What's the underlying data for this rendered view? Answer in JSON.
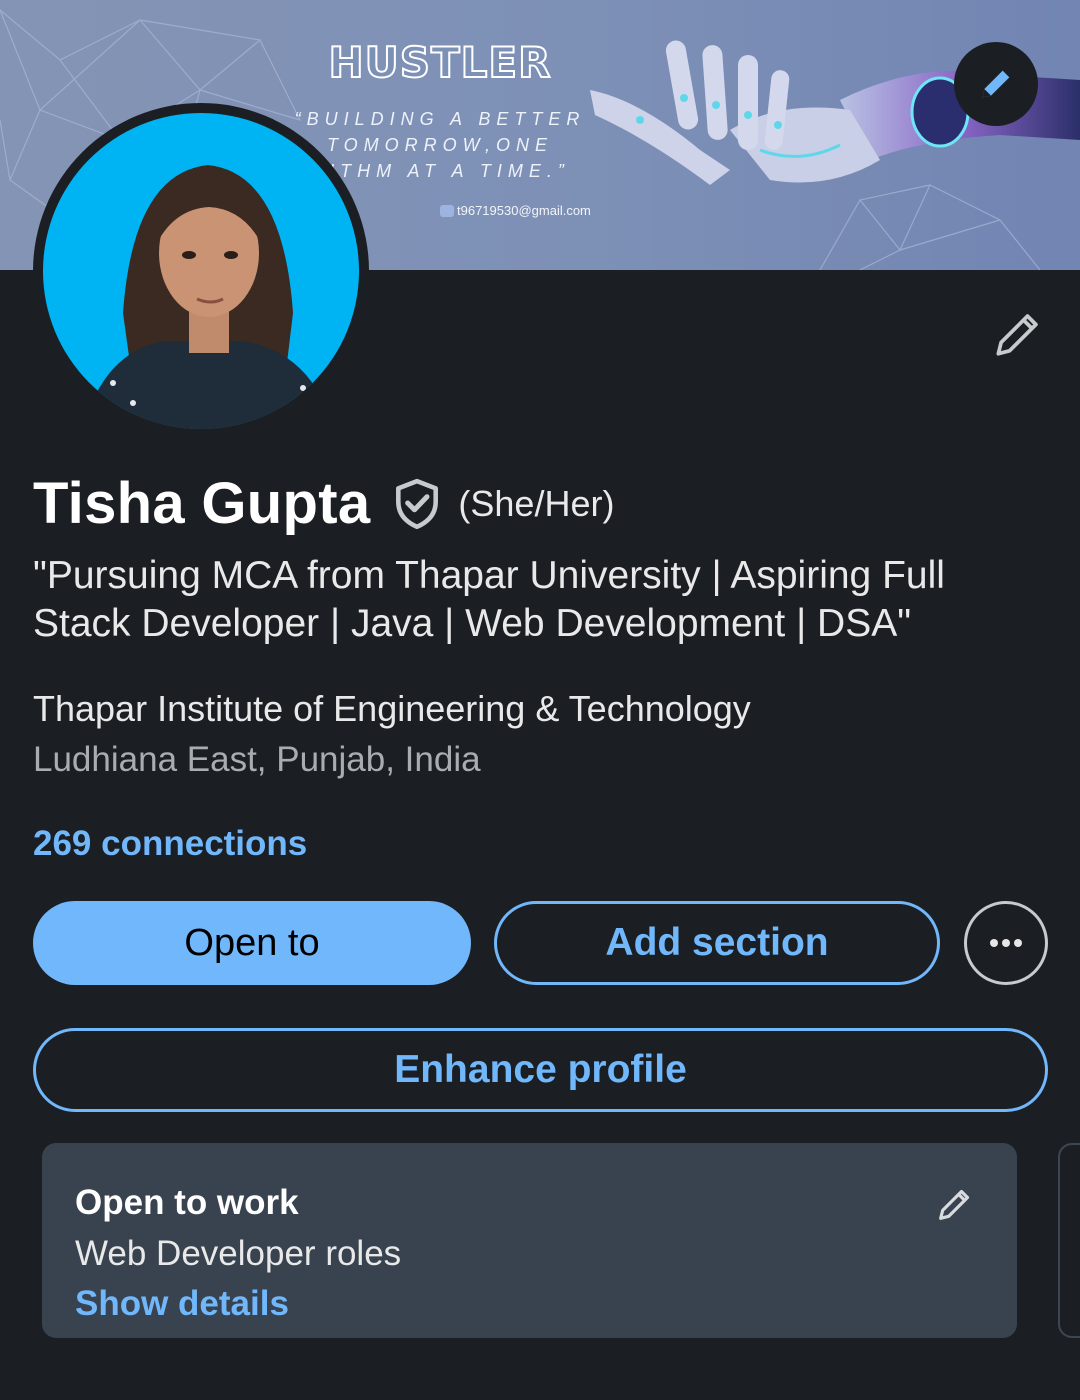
{
  "banner": {
    "title": "HUSTLER",
    "tagline": "“BUILDING A BETTER TOMORROW,ONE RITHM AT A TIME.”",
    "email": "t96719530@gmail.com"
  },
  "profile": {
    "name": "Tisha Gupta",
    "pronouns": "(She/Her)",
    "headline": "\"Pursuing MCA from Thapar University | Aspiring Full Stack Developer | Java | Web Development | DSA\"",
    "organization": "Thapar Institute of Engineering & Technology",
    "location": "Ludhiana East, Punjab, India",
    "connections": "269 connections"
  },
  "actions": {
    "open_to": "Open to",
    "add_section": "Add section",
    "enhance_profile": "Enhance profile"
  },
  "open_to_work": {
    "title": "Open to work",
    "roles": "Web Developer roles",
    "link": "Show details"
  },
  "icons": {
    "banner_edit": "pencil-icon",
    "intro_edit": "pencil-icon",
    "verified": "shield-check-icon",
    "more": "ellipsis-icon",
    "card_edit": "pencil-icon",
    "email": "mail-icon"
  },
  "colors": {
    "background": "#1b1f23",
    "accent": "#71b7fb",
    "banner": "#7d90b6",
    "avatar_bg": "#00b4f4",
    "card": "#38434f"
  }
}
